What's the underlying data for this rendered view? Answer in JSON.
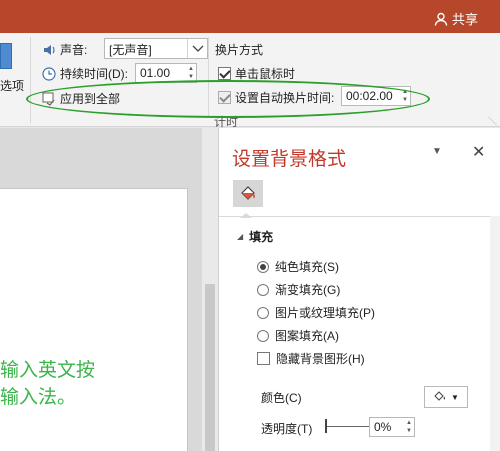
{
  "titlebar": {
    "share_label": "共享",
    "share_icon": "person-icon",
    "bg_color": "#b7472a"
  },
  "ribbon": {
    "left_option_label": "选项",
    "sound_label": "声音:",
    "sound_value": "[无声音]",
    "duration_label": "持续时间(D):",
    "duration_value": "01.00",
    "apply_all_label": "应用到全部",
    "advance_group_label": "换片方式",
    "on_click_label": "单击鼠标时",
    "auto_after_label": "设置自动换片时间:",
    "auto_after_value": "00:02.00",
    "timing_group_label": "计时"
  },
  "slide": {
    "text_line1": "输入英文按",
    "text_line2": "输入法。"
  },
  "format_pane": {
    "title": "设置背景格式",
    "section_fill": "填充",
    "options": [
      {
        "label": "纯色填充(S)",
        "checked": true
      },
      {
        "label": "渐变填充(G)",
        "checked": false
      },
      {
        "label": "图片或纹理填充(P)",
        "checked": false
      },
      {
        "label": "图案填充(A)",
        "checked": false
      }
    ],
    "hide_bg_label": "隐藏背景图形(H)",
    "color_label": "颜色(C)",
    "transparency_label": "透明度(T)",
    "transparency_value": "0%"
  }
}
